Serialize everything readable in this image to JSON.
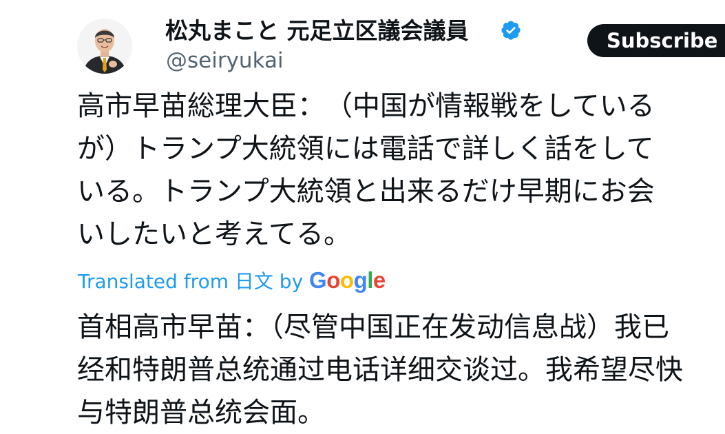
{
  "author": {
    "display_name": "松丸まこと 元足立区議会議員",
    "handle": "@seiryukai",
    "verified_icon": "verified-badge-icon",
    "avatar_icon": "profile-photo"
  },
  "subscribe_button": {
    "label": "Subscribe"
  },
  "post": {
    "original_lines": [
      "高市早苗総理大臣：　（中国が情報戦をしている",
      "が）トランプ大統領には電話で詳しく話をして",
      "いる。トランプ大統領と出来るだけ早期にお会",
      "いしたいと考えてる。"
    ],
    "translation": {
      "prefix": "Translated from",
      "language": "日文",
      "by": "by",
      "provider": "Google",
      "provider_letters": [
        "G",
        "o",
        "o",
        "g",
        "l",
        "e"
      ]
    },
    "translated_lines": [
      "首相高市早苗：（尽管中国正在发动信息战）我已",
      "经和特朗普总统通过电话详细交谈过。我希望尽快",
      "与特朗普总统会面。"
    ]
  },
  "colors": {
    "text": "#0f1419",
    "secondary": "#536471",
    "link": "#1d9bf0",
    "verified": "#1d9bf0",
    "button": "#0f1419"
  }
}
